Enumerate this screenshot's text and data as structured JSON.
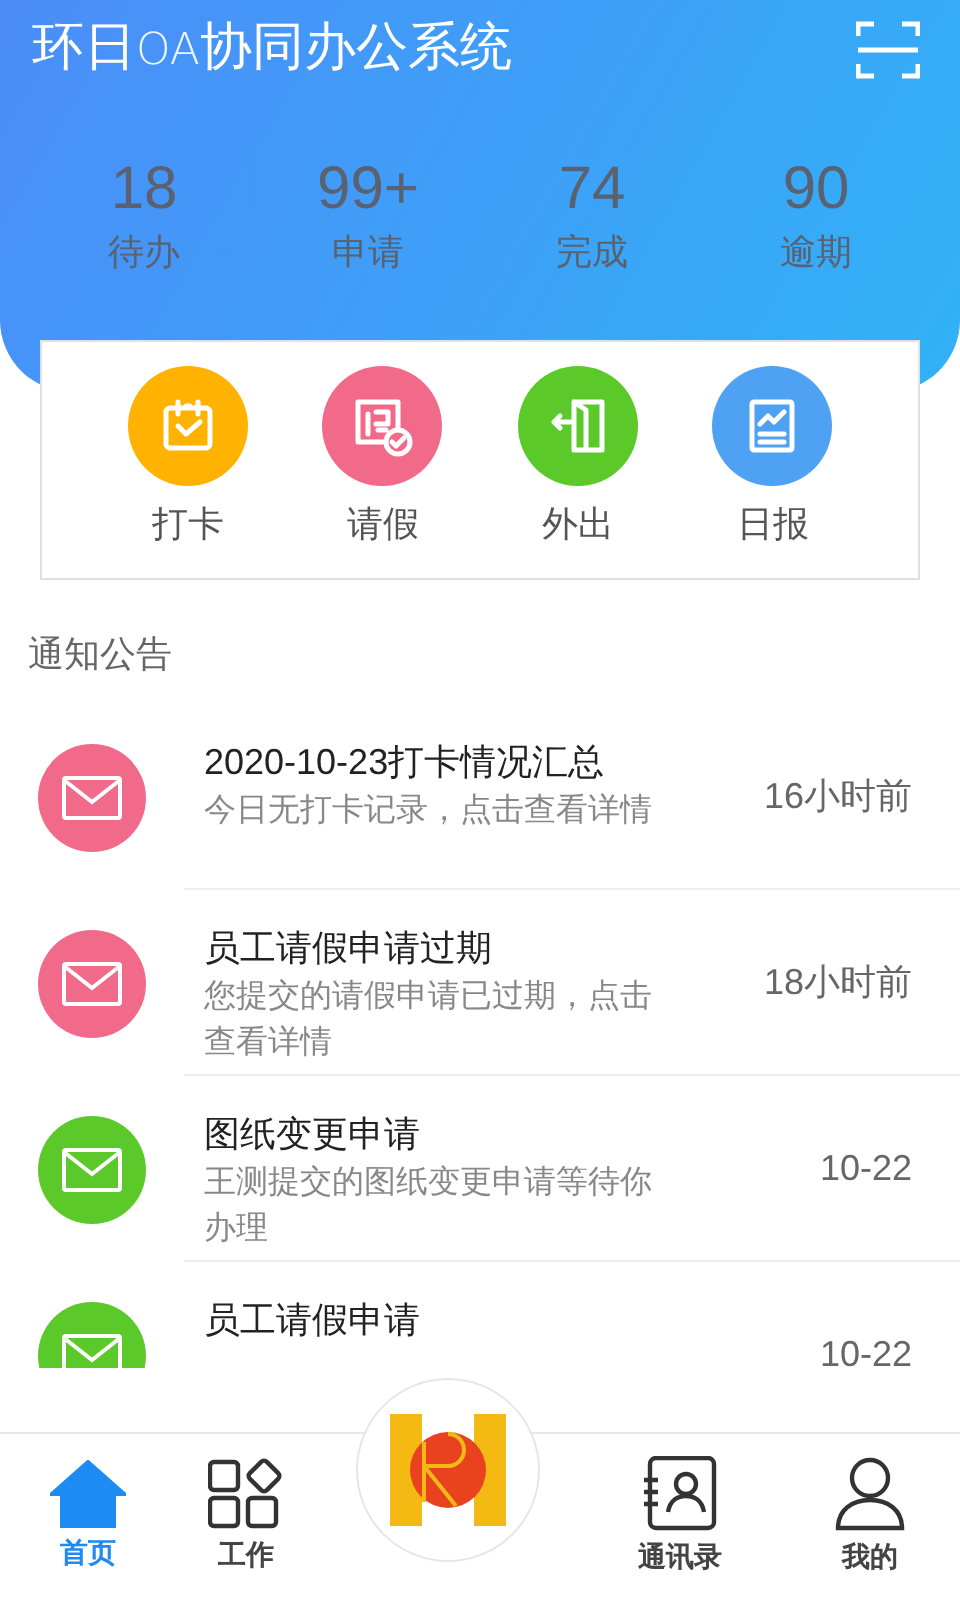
{
  "header": {
    "title_parts": [
      {
        "text": "环日",
        "kind": "bold"
      },
      {
        "text": "OA",
        "kind": "thin"
      },
      {
        "text": "协同办公系统",
        "kind": "bold"
      }
    ]
  },
  "stats": [
    {
      "value": "18",
      "label": "待办"
    },
    {
      "value": "99+",
      "label": "申请"
    },
    {
      "value": "74",
      "label": "完成"
    },
    {
      "value": "90",
      "label": "逾期"
    }
  ],
  "shortcuts": [
    {
      "label": "打卡",
      "kind": "clock",
      "color": "#ffb300"
    },
    {
      "label": "请假",
      "kind": "leave",
      "color": "#f26a8a"
    },
    {
      "label": "外出",
      "kind": "out",
      "color": "#5cc92a"
    },
    {
      "label": "日报",
      "kind": "report",
      "color": "#4ea1f3"
    }
  ],
  "notices_title": "通知公告",
  "notices": [
    {
      "title": "2020-10-23打卡情况汇总",
      "summary": "今日无打卡记录，点击查看详情",
      "time": "16小时前",
      "color": "#f26a8a"
    },
    {
      "title": "员工请假申请过期",
      "summary": "您提交的请假申请已过期，点击查看详情",
      "time": "18小时前",
      "color": "#f26a8a"
    },
    {
      "title": "图纸变更申请",
      "summary": "王测提交的图纸变更申请等待你办理",
      "time": "10-22",
      "color": "#5cc92a"
    },
    {
      "title": "员工请假申请",
      "time": "10-22",
      "color": "#5cc92a"
    }
  ],
  "nav": [
    {
      "label": "首页",
      "kind": "home",
      "selected": true
    },
    {
      "label": "工作",
      "kind": "work",
      "selected": false
    },
    {
      "kind": "logo",
      "selected": false
    },
    {
      "label": "通讯录",
      "kind": "contacts",
      "selected": false
    },
    {
      "label": "我的",
      "kind": "me",
      "selected": false
    }
  ]
}
